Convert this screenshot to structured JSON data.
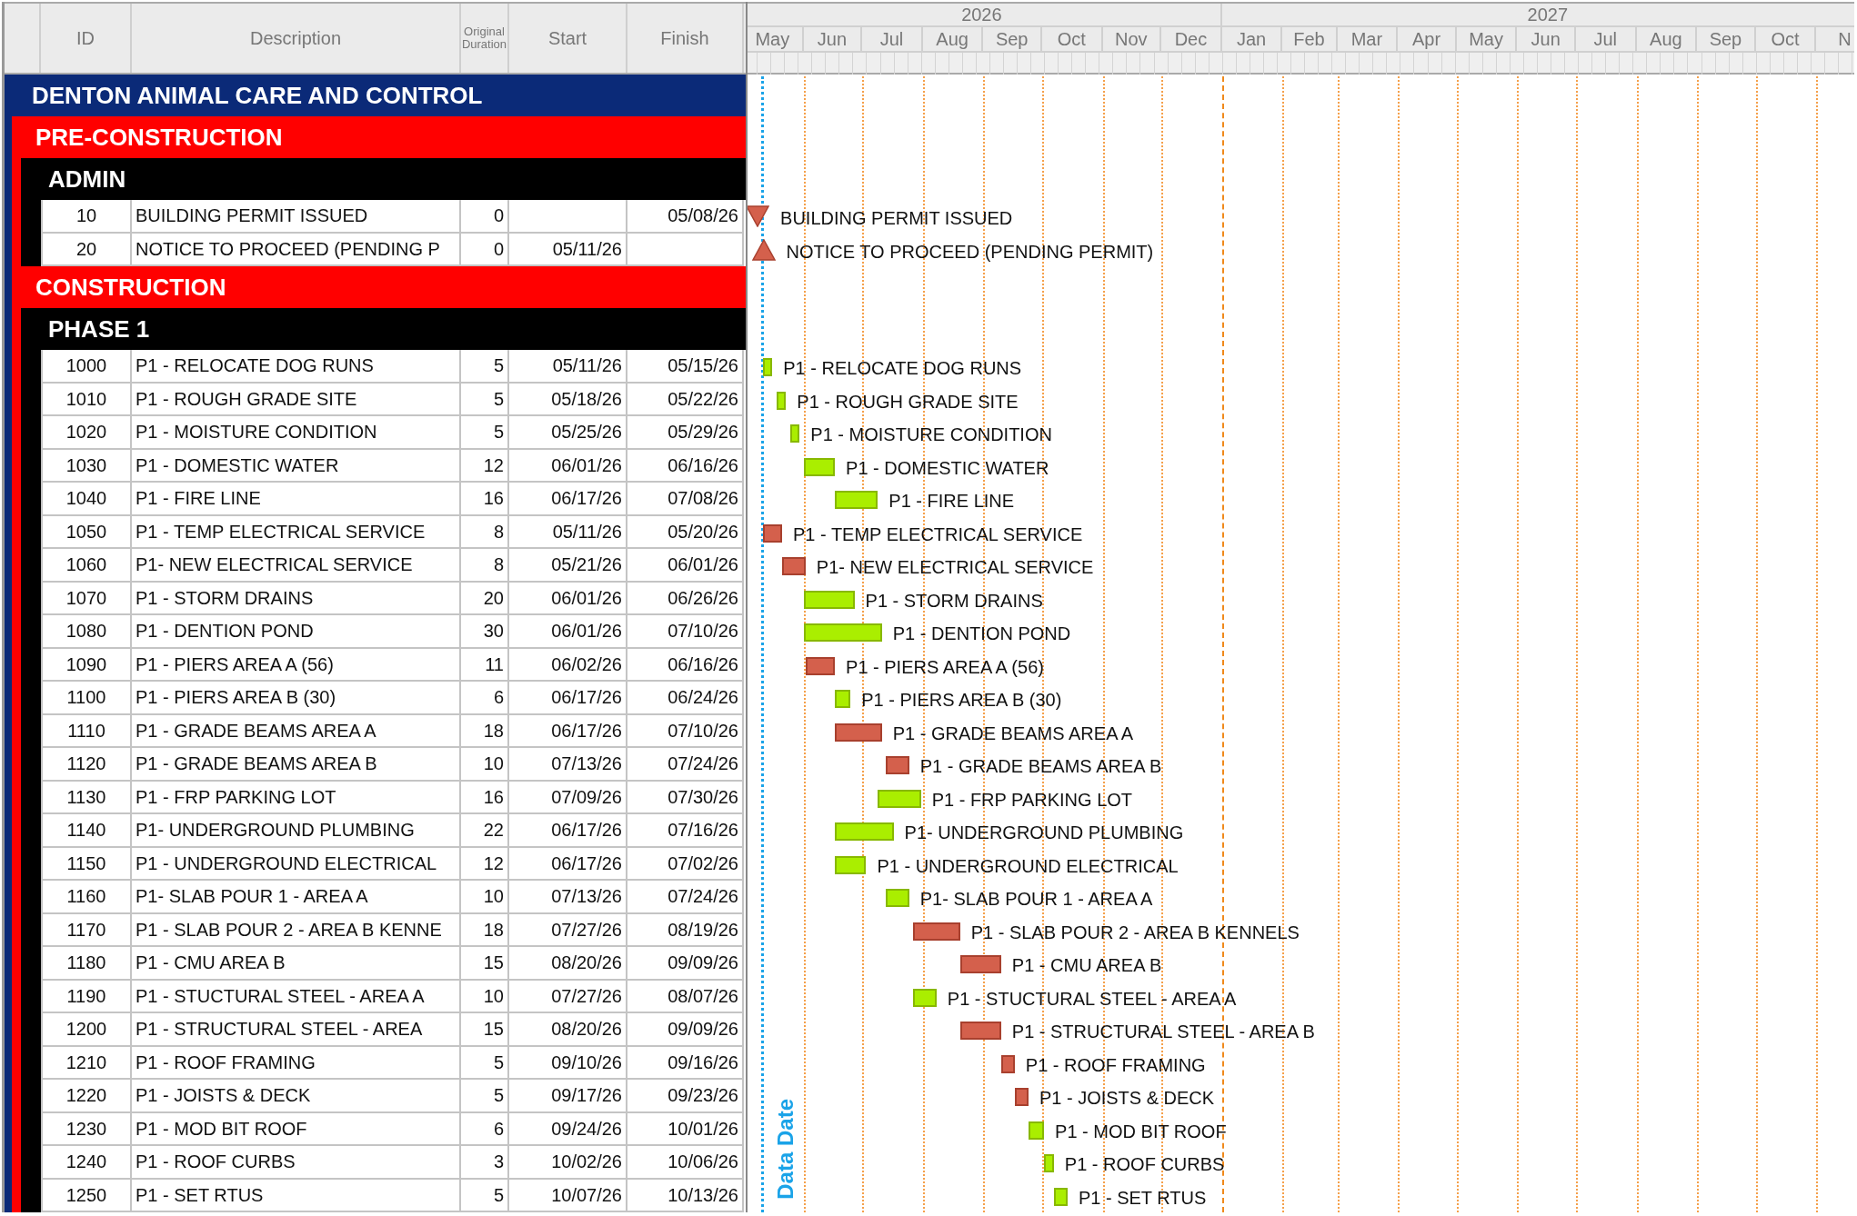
{
  "columns": [
    {
      "label": "ID"
    },
    {
      "label": "Description"
    },
    {
      "label": "Original Duration"
    },
    {
      "label": "Start"
    },
    {
      "label": "Finish"
    }
  ],
  "timeline": {
    "years": [
      {
        "label": "2026",
        "months": [
          "May",
          "Jun",
          "Jul",
          "Aug",
          "Sep",
          "Oct",
          "Nov",
          "Dec"
        ]
      },
      {
        "label": "2027",
        "months": [
          "Jan",
          "Feb",
          "Mar",
          "Apr",
          "May",
          "Jun",
          "Jul",
          "Aug",
          "Sep",
          "Oct",
          "N"
        ]
      }
    ]
  },
  "project": {
    "title": "DENTON ANIMAL CARE AND CONTROL",
    "phases": [
      {
        "title": "PRE-CONSTRUCTION",
        "groups": [
          {
            "title": "ADMIN",
            "activities": [
              {
                "id": "10",
                "description": "BUILDING PERMIT ISSUED",
                "duration": "0",
                "finish": "05/08/26",
                "kind": "finish-milestone",
                "bar_label": "BUILDING PERMIT ISSUED"
              },
              {
                "id": "20",
                "description": "NOTICE TO PROCEED (PENDING P",
                "duration": "0",
                "start": "05/11/26",
                "kind": "start-milestone",
                "bar_label": "NOTICE TO PROCEED (PENDING PERMIT)"
              }
            ]
          }
        ]
      },
      {
        "title": "CONSTRUCTION",
        "groups": [
          {
            "title": "PHASE 1",
            "activities": [
              {
                "id": "1000",
                "description": "P1 - RELOCATE DOG RUNS",
                "duration": "5",
                "start": "05/11/26",
                "finish": "05/15/26",
                "kind": "task",
                "critical": false,
                "bar_label": "P1 - RELOCATE DOG RUNS"
              },
              {
                "id": "1010",
                "description": "P1 - ROUGH GRADE SITE",
                "duration": "5",
                "start": "05/18/26",
                "finish": "05/22/26",
                "kind": "task",
                "critical": false,
                "bar_label": "P1 - ROUGH GRADE SITE"
              },
              {
                "id": "1020",
                "description": "P1 - MOISTURE CONDITION",
                "duration": "5",
                "start": "05/25/26",
                "finish": "05/29/26",
                "kind": "task",
                "critical": false,
                "bar_label": "P1 - MOISTURE CONDITION"
              },
              {
                "id": "1030",
                "description": "P1 - DOMESTIC WATER",
                "duration": "12",
                "start": "06/01/26",
                "finish": "06/16/26",
                "kind": "task",
                "critical": false,
                "bar_label": "P1 - DOMESTIC WATER"
              },
              {
                "id": "1040",
                "description": "P1 - FIRE LINE",
                "duration": "16",
                "start": "06/17/26",
                "finish": "07/08/26",
                "kind": "task",
                "critical": false,
                "bar_label": "P1 - FIRE LINE"
              },
              {
                "id": "1050",
                "description": "P1 - TEMP ELECTRICAL SERVICE",
                "duration": "8",
                "start": "05/11/26",
                "finish": "05/20/26",
                "kind": "task",
                "critical": true,
                "bar_label": "P1 - TEMP ELECTRICAL SERVICE"
              },
              {
                "id": "1060",
                "description": "P1- NEW ELECTRICAL SERVICE",
                "duration": "8",
                "start": "05/21/26",
                "finish": "06/01/26",
                "kind": "task",
                "critical": true,
                "bar_label": "P1- NEW ELECTRICAL SERVICE"
              },
              {
                "id": "1070",
                "description": "P1 - STORM DRAINS",
                "duration": "20",
                "start": "06/01/26",
                "finish": "06/26/26",
                "kind": "task",
                "critical": false,
                "bar_label": "P1 - STORM DRAINS"
              },
              {
                "id": "1080",
                "description": "P1 - DENTION POND",
                "duration": "30",
                "start": "06/01/26",
                "finish": "07/10/26",
                "kind": "task",
                "critical": false,
                "bar_label": "P1 - DENTION POND"
              },
              {
                "id": "1090",
                "description": "P1 - PIERS AREA A (56)",
                "duration": "11",
                "start": "06/02/26",
                "finish": "06/16/26",
                "kind": "task",
                "critical": true,
                "bar_label": "P1 - PIERS AREA A (56)"
              },
              {
                "id": "1100",
                "description": "P1 - PIERS AREA B (30)",
                "duration": "6",
                "start": "06/17/26",
                "finish": "06/24/26",
                "kind": "task",
                "critical": false,
                "bar_label": "P1 - PIERS AREA B (30)"
              },
              {
                "id": "1110",
                "description": "P1 - GRADE BEAMS AREA A",
                "duration": "18",
                "start": "06/17/26",
                "finish": "07/10/26",
                "kind": "task",
                "critical": true,
                "bar_label": "P1 - GRADE BEAMS AREA A"
              },
              {
                "id": "1120",
                "description": "P1 - GRADE BEAMS AREA B",
                "duration": "10",
                "start": "07/13/26",
                "finish": "07/24/26",
                "kind": "task",
                "critical": true,
                "bar_label": "P1 - GRADE BEAMS AREA B"
              },
              {
                "id": "1130",
                "description": "P1 - FRP PARKING LOT",
                "duration": "16",
                "start": "07/09/26",
                "finish": "07/30/26",
                "kind": "task",
                "critical": false,
                "bar_label": "P1 - FRP PARKING LOT"
              },
              {
                "id": "1140",
                "description": "P1- UNDERGROUND PLUMBING",
                "duration": "22",
                "start": "06/17/26",
                "finish": "07/16/26",
                "kind": "task",
                "critical": false,
                "bar_label": "P1- UNDERGROUND PLUMBING"
              },
              {
                "id": "1150",
                "description": "P1 - UNDERGROUND ELECTRICAL",
                "duration": "12",
                "start": "06/17/26",
                "finish": "07/02/26",
                "kind": "task",
                "critical": false,
                "bar_label": "P1 - UNDERGROUND ELECTRICAL"
              },
              {
                "id": "1160",
                "description": "P1- SLAB POUR 1 - AREA A",
                "duration": "10",
                "start": "07/13/26",
                "finish": "07/24/26",
                "kind": "task",
                "critical": false,
                "bar_label": "P1- SLAB POUR 1 - AREA A"
              },
              {
                "id": "1170",
                "description": "P1 - SLAB POUR 2 - AREA B KENNE",
                "duration": "18",
                "start": "07/27/26",
                "finish": "08/19/26",
                "kind": "task",
                "critical": true,
                "bar_label": "P1 - SLAB POUR 2 - AREA B KENNELS"
              },
              {
                "id": "1180",
                "description": "P1 - CMU AREA B",
                "duration": "15",
                "start": "08/20/26",
                "finish": "09/09/26",
                "kind": "task",
                "critical": true,
                "bar_label": "P1 - CMU AREA B"
              },
              {
                "id": "1190",
                "description": "P1 - STUCTURAL STEEL - AREA A",
                "duration": "10",
                "start": "07/27/26",
                "finish": "08/07/26",
                "kind": "task",
                "critical": false,
                "bar_label": "P1 - STUCTURAL STEEL - AREA A"
              },
              {
                "id": "1200",
                "description": "P1 - STRUCTURAL STEEL - AREA",
                "duration": "15",
                "start": "08/20/26",
                "finish": "09/09/26",
                "kind": "task",
                "critical": true,
                "bar_label": "P1 - STRUCTURAL STEEL - AREA B"
              },
              {
                "id": "1210",
                "description": "P1 - ROOF FRAMING",
                "duration": "5",
                "start": "09/10/26",
                "finish": "09/16/26",
                "kind": "task",
                "critical": true,
                "bar_label": "P1 - ROOF FRAMING"
              },
              {
                "id": "1220",
                "description": "P1 - JOISTS & DECK",
                "duration": "5",
                "start": "09/17/26",
                "finish": "09/23/26",
                "kind": "task",
                "critical": true,
                "bar_label": "P1 - JOISTS & DECK"
              },
              {
                "id": "1230",
                "description": "P1 - MOD BIT ROOF",
                "duration": "6",
                "start": "09/24/26",
                "finish": "10/01/26",
                "kind": "task",
                "critical": false,
                "bar_label": "P1 - MOD BIT ROOF"
              },
              {
                "id": "1240",
                "description": "P1 - ROOF CURBS",
                "duration": "3",
                "start": "10/02/26",
                "finish": "10/06/26",
                "kind": "task",
                "critical": false,
                "bar_label": "P1 - ROOF CURBS"
              },
              {
                "id": "1250",
                "description": "P1 - SET RTUS",
                "duration": "5",
                "start": "10/07/26",
                "finish": "10/13/26",
                "kind": "task",
                "critical": false,
                "bar_label": "P1 - SET RTUS"
              }
            ]
          }
        ]
      }
    ]
  },
  "data_date_label": "Data Date"
}
